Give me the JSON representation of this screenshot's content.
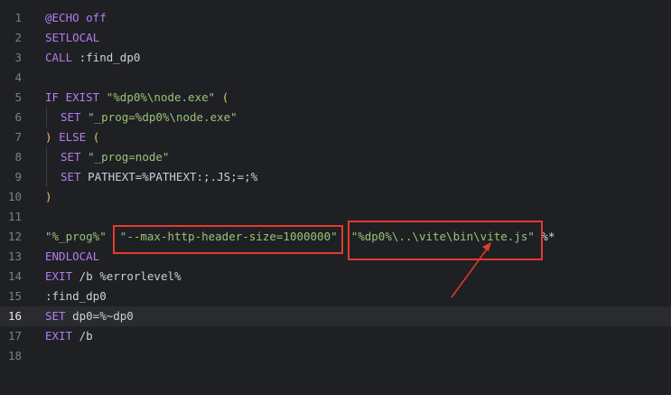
{
  "editor": {
    "lines": [
      {
        "n": "1",
        "parts": [
          {
            "t": "@ECHO off",
            "c": "kw"
          }
        ]
      },
      {
        "n": "2",
        "parts": [
          {
            "t": "SETLOCAL",
            "c": "kw"
          }
        ]
      },
      {
        "n": "3",
        "parts": [
          {
            "t": "CALL",
            "c": "kw"
          },
          {
            "t": " :find_dp0",
            "c": "plain"
          }
        ]
      },
      {
        "n": "4",
        "parts": []
      },
      {
        "n": "5",
        "parts": [
          {
            "t": "IF EXIST",
            "c": "kw"
          },
          {
            "t": " ",
            "c": "plain"
          },
          {
            "t": "\"%dp0%\\node.exe\"",
            "c": "str"
          },
          {
            "t": " ",
            "c": "plain"
          },
          {
            "t": "(",
            "c": "paren"
          }
        ]
      },
      {
        "n": "6",
        "indent": 1,
        "parts": [
          {
            "t": "SET",
            "c": "kw"
          },
          {
            "t": " ",
            "c": "plain"
          },
          {
            "t": "\"_prog=%dp0%\\node.exe\"",
            "c": "str"
          }
        ]
      },
      {
        "n": "7",
        "parts": [
          {
            "t": ")",
            "c": "paren"
          },
          {
            "t": " ",
            "c": "plain"
          },
          {
            "t": "ELSE",
            "c": "kw"
          },
          {
            "t": " ",
            "c": "plain"
          },
          {
            "t": "(",
            "c": "paren"
          }
        ]
      },
      {
        "n": "8",
        "indent": 1,
        "parts": [
          {
            "t": "SET",
            "c": "kw"
          },
          {
            "t": " ",
            "c": "plain"
          },
          {
            "t": "\"_prog=node\"",
            "c": "str"
          }
        ]
      },
      {
        "n": "9",
        "indent": 1,
        "parts": [
          {
            "t": "SET",
            "c": "kw"
          },
          {
            "t": " PATHEXT=%PATHEXT:;.JS;=;%",
            "c": "plain"
          }
        ]
      },
      {
        "n": "10",
        "parts": [
          {
            "t": ")",
            "c": "paren"
          }
        ]
      },
      {
        "n": "11",
        "parts": []
      },
      {
        "n": "12",
        "parts": [
          {
            "t": "\"%_prog%\"",
            "c": "str"
          },
          {
            "t": "  ",
            "c": "plain"
          },
          {
            "t": "\"--max-http-header-size=1000000\"",
            "c": "str"
          },
          {
            "t": "  ",
            "c": "plain"
          },
          {
            "t": "\"%dp0%\\..\\vite\\bin\\vite.js\"",
            "c": "str"
          },
          {
            "t": " %*",
            "c": "pct"
          }
        ]
      },
      {
        "n": "13",
        "parts": [
          {
            "t": "ENDLOCAL",
            "c": "kw"
          }
        ]
      },
      {
        "n": "14",
        "parts": [
          {
            "t": "EXIT",
            "c": "kw"
          },
          {
            "t": " /b %errorlevel%",
            "c": "plain"
          }
        ]
      },
      {
        "n": "15",
        "parts": [
          {
            "t": ":find_dp0",
            "c": "plain"
          }
        ]
      },
      {
        "n": "16",
        "active": true,
        "parts": [
          {
            "t": "SET",
            "c": "kw"
          },
          {
            "t": " dp0=%~dp0",
            "c": "plain"
          }
        ]
      },
      {
        "n": "17",
        "parts": [
          {
            "t": "EXIT",
            "c": "kw"
          },
          {
            "t": " /b",
            "c": "plain"
          }
        ]
      },
      {
        "n": "18",
        "parts": []
      }
    ]
  },
  "colors": {
    "annotation": "#e33b2e"
  },
  "annotations": {
    "highlight_boxes": [
      "--max-http-header-size argument",
      "vite.js path argument"
    ],
    "arrow": "points to vite.js path"
  }
}
